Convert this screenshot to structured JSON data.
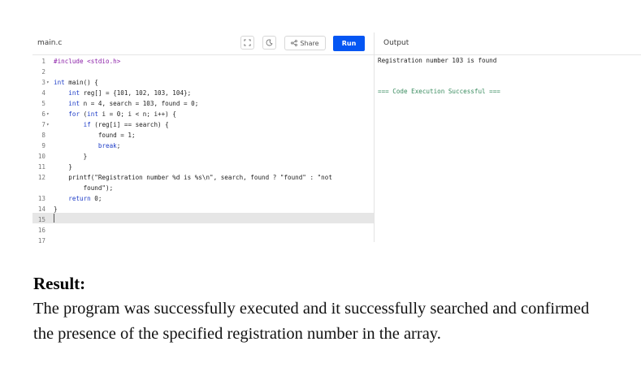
{
  "editor": {
    "file_tab": "main.c",
    "share_label": "Share",
    "run_label": "Run",
    "fullscreen_icon": "fullscreen-icon",
    "theme_icon": "theme-toggle-icon",
    "share_icon": "share-icon",
    "code_lines": [
      {
        "num": "1",
        "fold": "",
        "text": "#include <stdio.h>"
      },
      {
        "num": "2",
        "fold": "",
        "text": ""
      },
      {
        "num": "3",
        "fold": "▾",
        "text": "int main() {"
      },
      {
        "num": "4",
        "fold": "",
        "text": "    int reg[] = {101, 102, 103, 104};"
      },
      {
        "num": "5",
        "fold": "",
        "text": "    int n = 4, search = 103, found = 0;"
      },
      {
        "num": "6",
        "fold": "▾",
        "text": "    for (int i = 0; i < n; i++) {"
      },
      {
        "num": "7",
        "fold": "▾",
        "text": "        if (reg[i] == search) {"
      },
      {
        "num": "8",
        "fold": "",
        "text": "            found = 1;"
      },
      {
        "num": "9",
        "fold": "",
        "text": "            break;"
      },
      {
        "num": "10",
        "fold": "",
        "text": "        }"
      },
      {
        "num": "11",
        "fold": "",
        "text": "    }"
      },
      {
        "num": "12",
        "fold": "",
        "text": "    printf(\"Registration number %d is %s\\n\", search, found ? \"found\" : \"not"
      },
      {
        "num": "",
        "fold": "",
        "text": "        found\");"
      },
      {
        "num": "13",
        "fold": "",
        "text": "    return 0;"
      },
      {
        "num": "14",
        "fold": "",
        "text": "}"
      },
      {
        "num": "15",
        "fold": "",
        "text": ""
      },
      {
        "num": "16",
        "fold": "",
        "text": ""
      },
      {
        "num": "17",
        "fold": "",
        "text": ""
      }
    ]
  },
  "output": {
    "title": "Output",
    "result_line": "Registration number 103 is found",
    "status_line": "=== Code Execution Successful ==="
  },
  "result": {
    "heading": "Result:",
    "paragraph": "The program was successfully executed and it successfully searched and confirmed the presence of the specified registration number in the array."
  },
  "colors": {
    "run_button": "#0556f3",
    "status_text": "#3a8c5f",
    "current_line": "#e6e6e6"
  }
}
